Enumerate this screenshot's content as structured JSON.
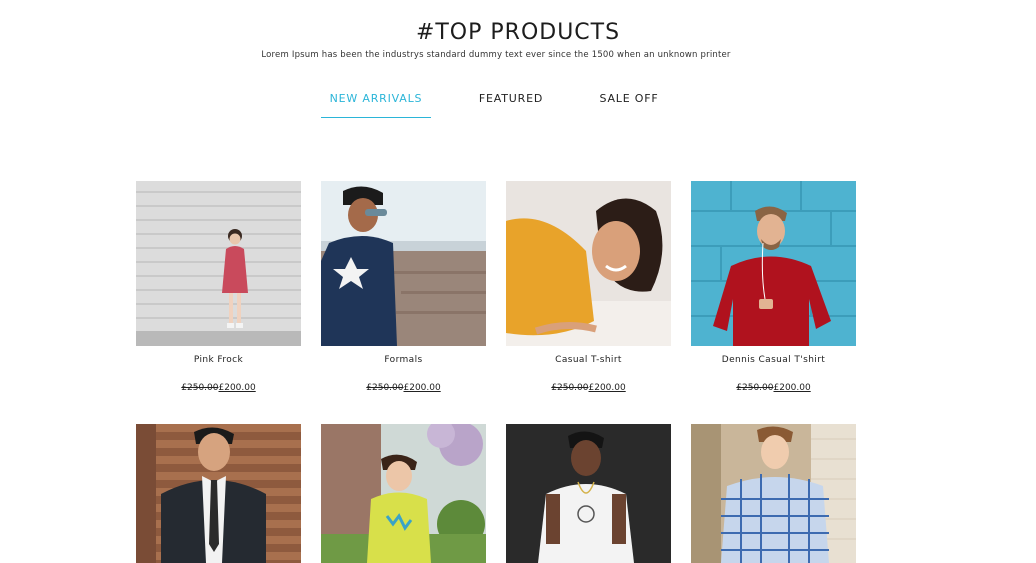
{
  "header": {
    "title": "#TOP PRODUCTS",
    "subtitle": "Lorem Ipsum has been the industrys standard dummy text ever since the 1500 when an unknown printer"
  },
  "tabs": [
    {
      "label": "NEW ARRIVALS",
      "active": true
    },
    {
      "label": "FEATURED",
      "active": false
    },
    {
      "label": "SALE OFF",
      "active": false
    }
  ],
  "colors": {
    "accent": "#2bb5d8"
  },
  "products": [
    {
      "name": "Pink Frock",
      "old_price": "£250.00",
      "new_price": "£200.00"
    },
    {
      "name": "Formals",
      "old_price": "£250.00",
      "new_price": "£200.00"
    },
    {
      "name": "Casual T-shirt",
      "old_price": "£250.00",
      "new_price": "£200.00"
    },
    {
      "name": "Dennis Casual T'shirt",
      "old_price": "£250.00",
      "new_price": "£200.00"
    },
    {
      "name": "",
      "old_price": "",
      "new_price": ""
    },
    {
      "name": "",
      "old_price": "",
      "new_price": ""
    },
    {
      "name": "",
      "old_price": "",
      "new_price": ""
    },
    {
      "name": "",
      "old_price": "",
      "new_price": ""
    }
  ]
}
